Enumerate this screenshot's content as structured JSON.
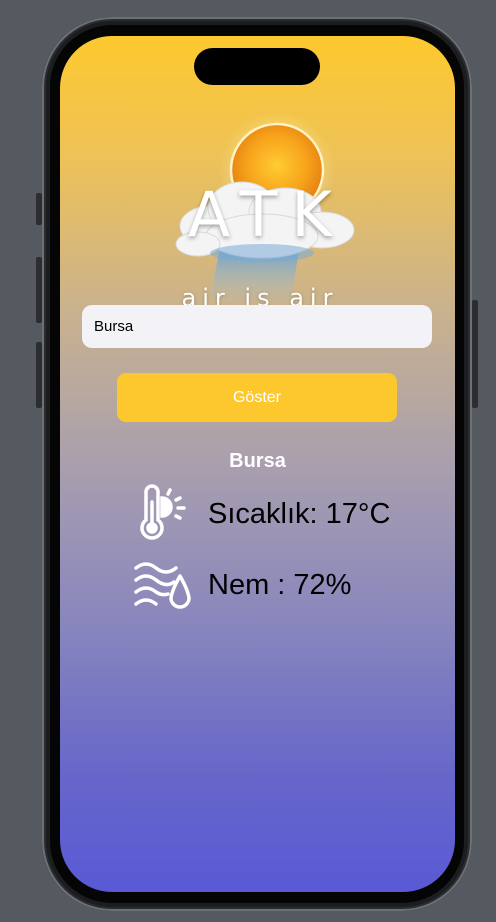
{
  "app": {
    "logo_title": "ATK",
    "logo_tagline": "air is air"
  },
  "search": {
    "value": "Bursa",
    "placeholder": ""
  },
  "actions": {
    "show_label": "Göster"
  },
  "weather": {
    "city": "Bursa",
    "temperature_text": "Sıcaklık: 17°C",
    "humidity_text": "Nem : 72%",
    "temperature_icon": "thermometer-sun-icon",
    "humidity_icon": "wind-drop-icon"
  },
  "colors": {
    "accent": "#fdc82e",
    "gradient_top": "#fdc92e",
    "gradient_bottom": "#5a59d6"
  }
}
